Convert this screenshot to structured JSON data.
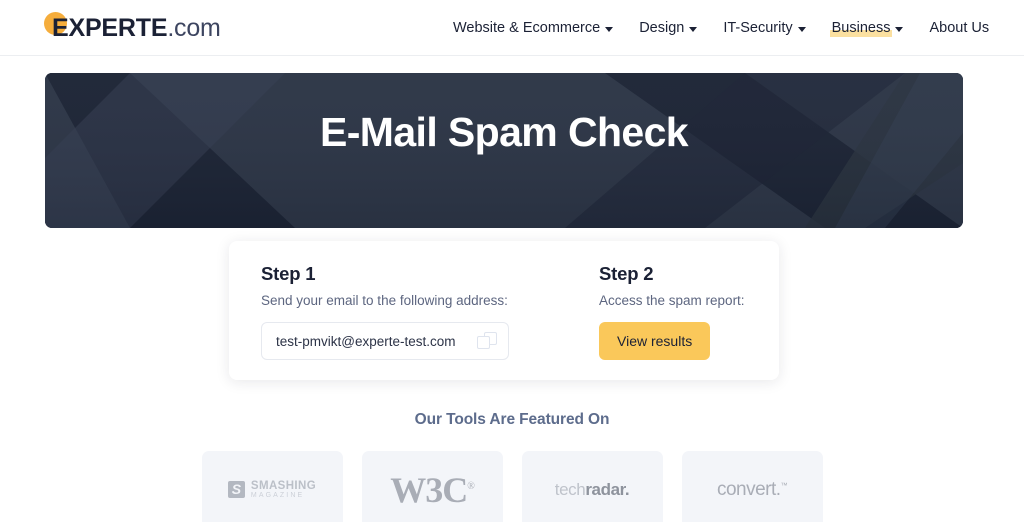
{
  "header": {
    "logo": {
      "mark": "logo-dot",
      "main": "EXPERTE",
      "suffix": ".com"
    },
    "nav": [
      {
        "label": "Website & Ecommerce",
        "has_caret": true,
        "active": false
      },
      {
        "label": "Design",
        "has_caret": true,
        "active": false
      },
      {
        "label": "IT-Security",
        "has_caret": true,
        "active": false
      },
      {
        "label": "Business",
        "has_caret": true,
        "active": true
      },
      {
        "label": "About Us",
        "has_caret": false,
        "active": false
      }
    ]
  },
  "hero": {
    "title": "E-Mail Spam Check",
    "bg_color": "#2b3445",
    "bg_dark": "#1c2435"
  },
  "card": {
    "step1": {
      "title": "Step 1",
      "subtitle": "Send your email to the following address:",
      "email": "test-pmvikt@experte-test.com",
      "copy_icon": "copy-icon"
    },
    "step2": {
      "title": "Step 2",
      "subtitle": "Access the spam report:",
      "button_label": "View results",
      "button_color": "#fac85a"
    }
  },
  "featured": {
    "title": "Our Tools Are Featured On",
    "logos": [
      {
        "name": "Smashing Magazine",
        "line1": "SMASHING",
        "line2": "MAGAZINE"
      },
      {
        "name": "W3C",
        "text": "W3C",
        "sup": "®"
      },
      {
        "name": "techradar",
        "part1": "tech",
        "part2": "radar."
      },
      {
        "name": "convert",
        "text": "convert.",
        "sup": "™"
      }
    ]
  }
}
